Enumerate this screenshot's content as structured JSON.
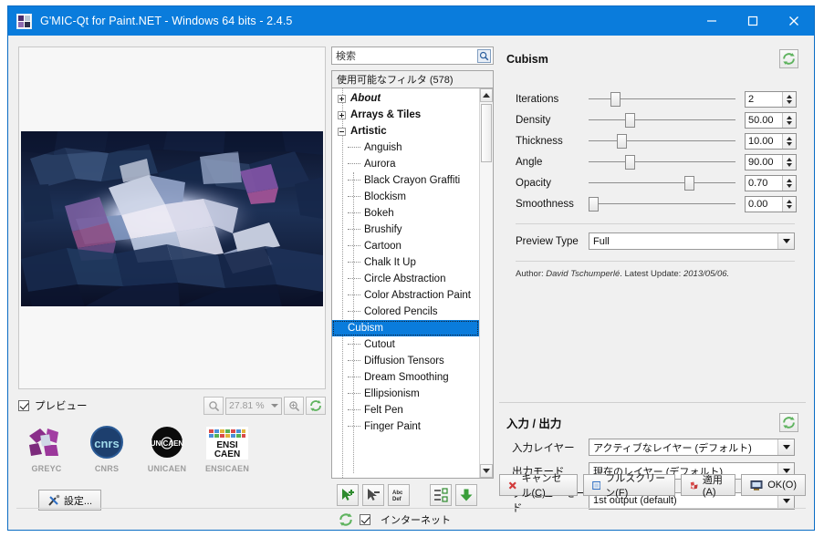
{
  "window": {
    "title": "G'MIC-Qt for Paint.NET - Windows 64 bits - 2.4.5",
    "icon": "gmic-app-icon",
    "minimize": "–",
    "maximize": "☐",
    "close": "✕",
    "titlebar_color": "#0a7cdc"
  },
  "preview": {
    "checkbox_label": "プレビュー",
    "checkbox_checked": true,
    "zoom_value": "27.81 %",
    "zoom_out_icon": "zoom-out-icon",
    "zoom_in_icon": "zoom-in-icon",
    "reset_icon": "refresh-icon"
  },
  "logos": [
    {
      "caption": "GREYC",
      "name": "greyc-logo"
    },
    {
      "caption": "CNRS",
      "name": "cnrs-logo"
    },
    {
      "caption": "UNICAEN",
      "name": "unicaen-logo"
    },
    {
      "caption": "ENSICAEN",
      "name": "ensicaen-logo"
    }
  ],
  "settings": {
    "label": "設定...",
    "icon": "tools-icon"
  },
  "search": {
    "placeholder": "検索",
    "value": "",
    "icon": "search-icon"
  },
  "filter_list": {
    "header": "使用可能なフィルタ (578)",
    "selected": "Cubism",
    "items": [
      {
        "label": "About",
        "type": "group",
        "expanded": false,
        "italic": true
      },
      {
        "label": "Arrays & Tiles",
        "type": "group",
        "expanded": false,
        "italic": false
      },
      {
        "label": "Artistic",
        "type": "group",
        "expanded": true,
        "italic": false
      },
      {
        "label": "Anguish",
        "type": "leaf"
      },
      {
        "label": "Aurora",
        "type": "leaf"
      },
      {
        "label": "Black Crayon Graffiti",
        "type": "leaf"
      },
      {
        "label": "Blockism",
        "type": "leaf"
      },
      {
        "label": "Bokeh",
        "type": "leaf"
      },
      {
        "label": "Brushify",
        "type": "leaf"
      },
      {
        "label": "Cartoon",
        "type": "leaf"
      },
      {
        "label": "Chalk It Up",
        "type": "leaf"
      },
      {
        "label": "Circle Abstraction",
        "type": "leaf"
      },
      {
        "label": "Color Abstraction Paint",
        "type": "leaf"
      },
      {
        "label": "Colored Pencils",
        "type": "leaf"
      },
      {
        "label": "Cubism",
        "type": "leaf",
        "selected": true
      },
      {
        "label": "Cutout",
        "type": "leaf"
      },
      {
        "label": "Diffusion Tensors",
        "type": "leaf"
      },
      {
        "label": "Dream Smoothing",
        "type": "leaf"
      },
      {
        "label": "Ellipsionism",
        "type": "leaf"
      },
      {
        "label": "Felt Pen",
        "type": "leaf"
      },
      {
        "label": "Finger Paint",
        "type": "leaf"
      }
    ]
  },
  "list_toolbar": {
    "buttons": [
      {
        "name": "add-fave-icon",
        "label": ""
      },
      {
        "name": "remove-fave-icon",
        "label": ""
      },
      {
        "name": "rename-fave-icon",
        "label": "Abc Def"
      },
      {
        "name": "expand-collapse-icon",
        "label": ""
      },
      {
        "name": "update-filters-icon",
        "label": ""
      }
    ],
    "refresh_icon": "refresh-icon",
    "internet_label": "インターネット",
    "internet_checked": true
  },
  "filter_panel": {
    "title": "Cubism",
    "refresh_icon": "refresh-icon",
    "parameters": [
      {
        "label": "Iterations",
        "value": "2",
        "slider_pct": 15
      },
      {
        "label": "Density",
        "value": "50.00",
        "slider_pct": 25
      },
      {
        "label": "Thickness",
        "value": "10.00",
        "slider_pct": 19
      },
      {
        "label": "Angle",
        "value": "90.00",
        "slider_pct": 25
      },
      {
        "label": "Opacity",
        "value": "0.70",
        "slider_pct": 65
      },
      {
        "label": "Smoothness",
        "value": "0.00",
        "slider_pct": 1
      }
    ],
    "preview_type": {
      "label": "Preview Type",
      "value": "Full"
    },
    "author_prefix": "Author: ",
    "author_name": "David Tschumperlé",
    "update_prefix": ". Latest Update: ",
    "update_date": "2013/05/06."
  },
  "io_panel": {
    "title": "入力 / 出力",
    "refresh_icon": "refresh-icon",
    "rows": [
      {
        "label": "入力レイヤー",
        "value": "アクティブなレイヤー (デフォルト)"
      },
      {
        "label": "出力モード",
        "value": "現在のレイヤー (デフォルト)"
      },
      {
        "label": "プレビューモード",
        "value": "1st output (default)"
      }
    ]
  },
  "buttons": [
    {
      "label": "キャンセル(C)",
      "icon": "cancel-icon",
      "name": "cancel-button"
    },
    {
      "label": "フルスクリーン(F)",
      "icon": "fullscreen-icon",
      "name": "fullscreen-button"
    },
    {
      "label": "適用(A)",
      "icon": "apply-icon",
      "name": "apply-button"
    },
    {
      "label": "OK(O)",
      "icon": "ok-icon",
      "name": "ok-button"
    }
  ]
}
